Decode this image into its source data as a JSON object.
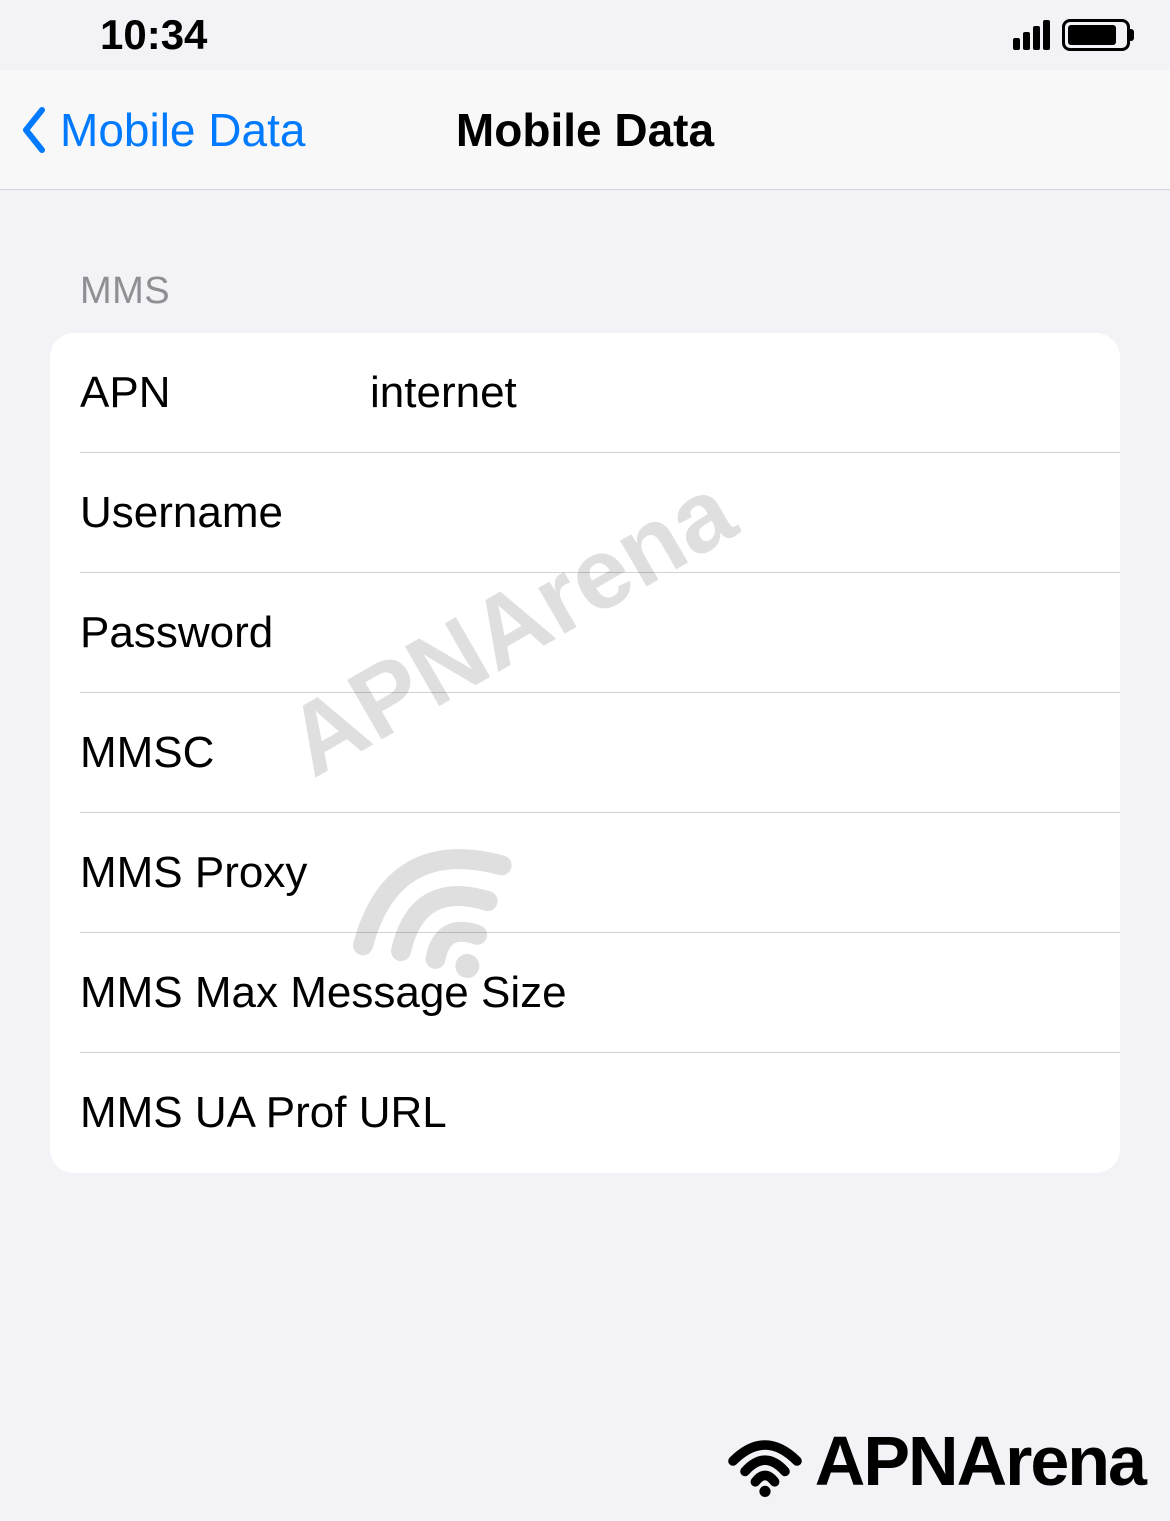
{
  "status_bar": {
    "time": "10:34"
  },
  "nav": {
    "back_label": "Mobile Data",
    "title": "Mobile Data"
  },
  "section": {
    "header": "MMS"
  },
  "rows": {
    "apn": {
      "label": "APN",
      "value": "internet"
    },
    "username": {
      "label": "Username",
      "value": ""
    },
    "password": {
      "label": "Password",
      "value": ""
    },
    "mmsc": {
      "label": "MMSC",
      "value": ""
    },
    "mms_proxy": {
      "label": "MMS Proxy",
      "value": ""
    },
    "mms_max_size": {
      "label": "MMS Max Message Size",
      "value": ""
    },
    "mms_ua_prof": {
      "label": "MMS UA Prof URL",
      "value": ""
    }
  },
  "watermark": {
    "text": "APNArena"
  },
  "footer": {
    "text": "APNArena"
  }
}
